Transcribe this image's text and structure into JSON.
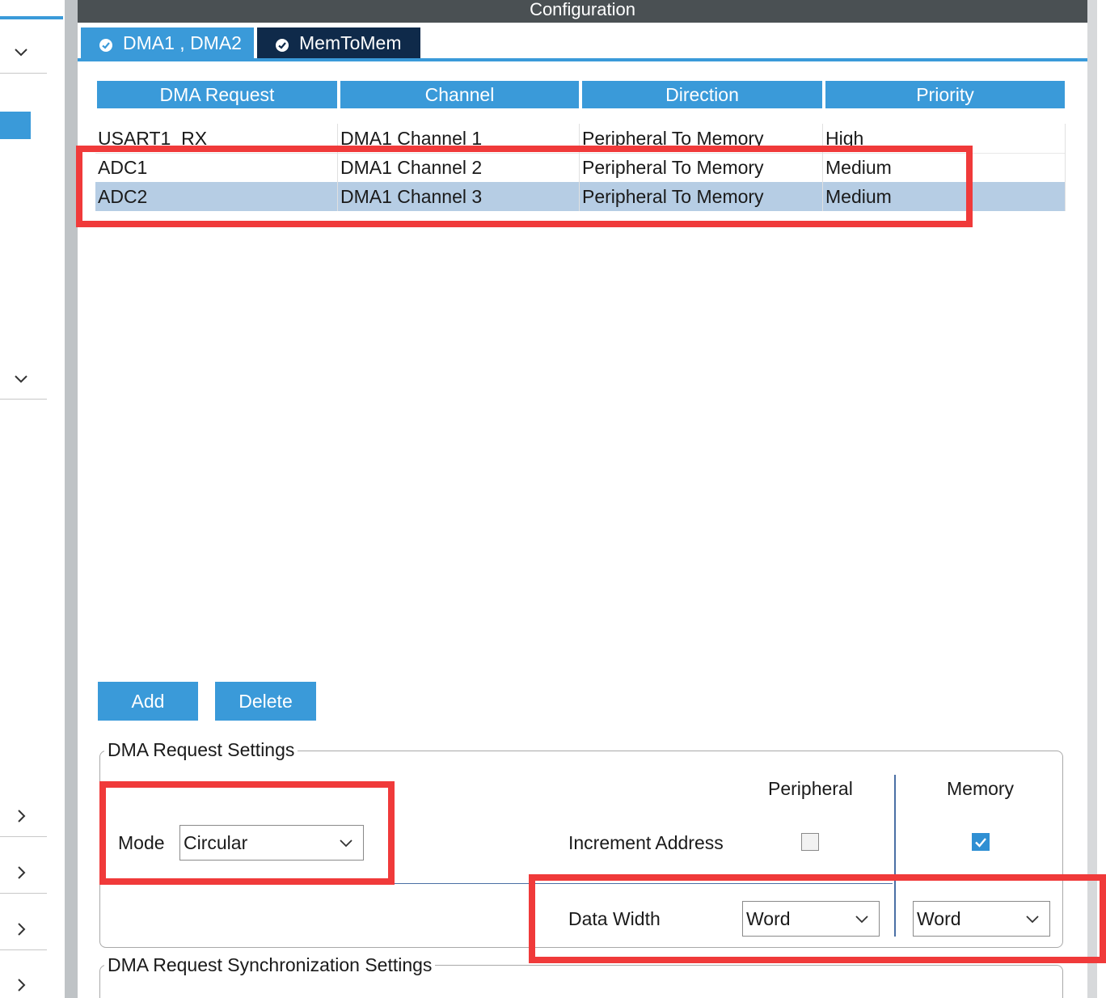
{
  "window": {
    "title": "Configuration"
  },
  "tabs": [
    {
      "label": "DMA1 , DMA2",
      "active": true
    },
    {
      "label": "MemToMem",
      "active": false
    }
  ],
  "table": {
    "columns": [
      "DMA Request",
      "Channel",
      "Direction",
      "Priority"
    ],
    "rows": [
      {
        "request": "USART1_RX",
        "channel": "DMA1 Channel 1",
        "direction": "Peripheral To Memory",
        "priority": "High"
      },
      {
        "request": "ADC1",
        "channel": "DMA1 Channel 2",
        "direction": "Peripheral To Memory",
        "priority": "Medium"
      },
      {
        "request": "ADC2",
        "channel": "DMA1 Channel 3",
        "direction": "Peripheral To Memory",
        "priority": "Medium"
      }
    ],
    "selected_row": 2
  },
  "buttons": {
    "add": "Add",
    "delete": "Delete"
  },
  "settings": {
    "title": "DMA Request Settings",
    "mode_label": "Mode",
    "mode_value": "Circular",
    "peripheral_header": "Peripheral",
    "memory_header": "Memory",
    "increment_label": "Increment Address",
    "increment_peripheral": false,
    "increment_memory": true,
    "data_width_label": "Data Width",
    "data_width_peripheral": "Word",
    "data_width_memory": "Word"
  },
  "sync": {
    "title": "DMA Request Synchronization Settings"
  },
  "colors": {
    "accent": "#3a9ad9",
    "tab_dark": "#0f2a4a",
    "titlebar": "#4a5053",
    "selected_row": "#b6cde4",
    "annotation_red": "#f03a3a"
  }
}
